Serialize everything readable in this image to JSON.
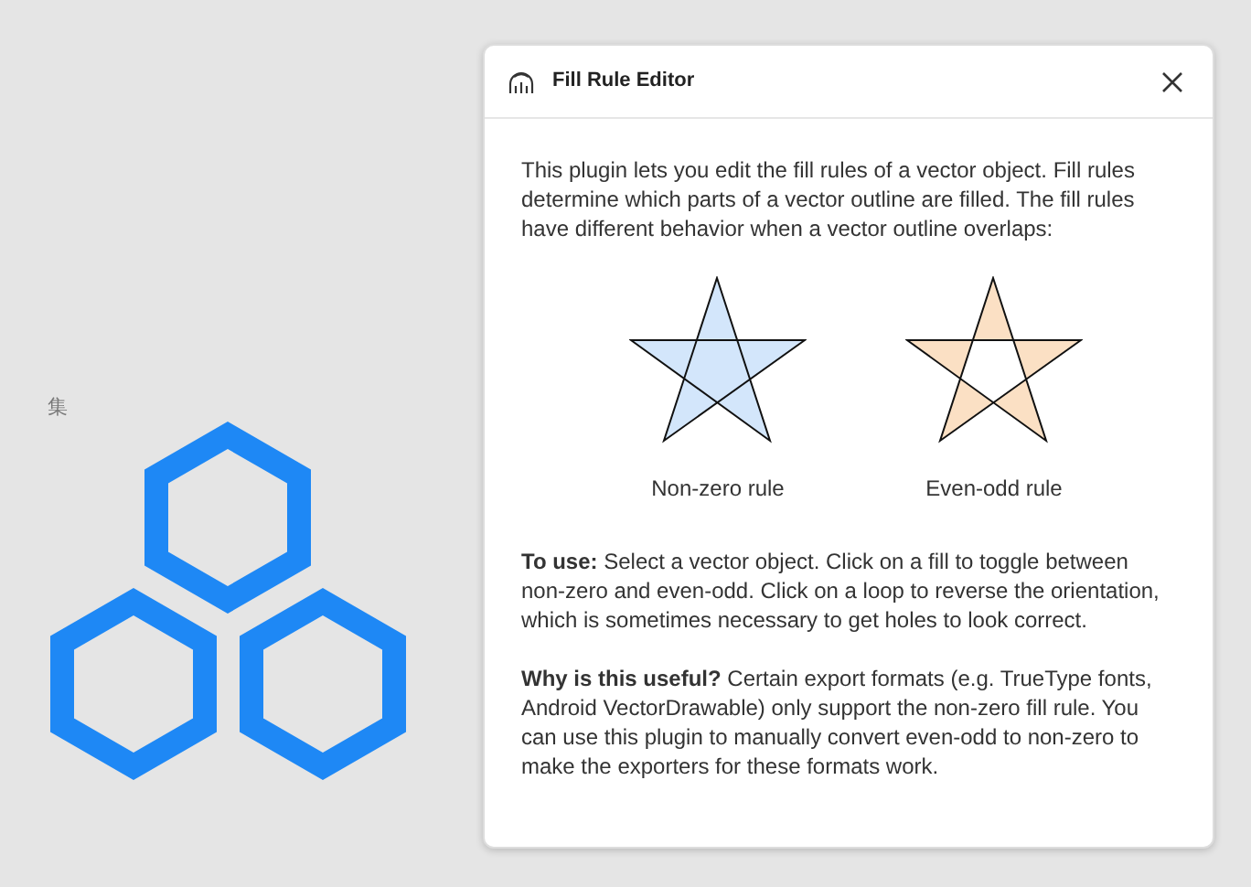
{
  "canvas": {
    "label": "集"
  },
  "dialog": {
    "title": "Fill Rule Editor",
    "intro": "This plugin lets you edit the fill rules of a vector object. Fill rules determine which parts of a vector outline are filled. The fill rules have different behavior when a vector outline overlaps:",
    "examples": [
      {
        "kind": "nonzero",
        "label": "Non-zero rule",
        "color": "#d3e6fb"
      },
      {
        "kind": "evenodd",
        "label": "Even-odd rule",
        "color": "#fbe0c4"
      }
    ],
    "paragraphs": [
      "**To use:** Select a vector object. Click on a fill to toggle between non-zero and even-odd. Click on a loop to reverse the orientation, which is sometimes necessary to get holes to look correct.",
      "**Why is this useful?** Certain export formats (e.g. TrueType fonts, Android VectorDrawable) only support the non-zero fill rule. You can use this plugin to manually convert even-odd to non-zero to make the exporters for these formats work."
    ]
  }
}
